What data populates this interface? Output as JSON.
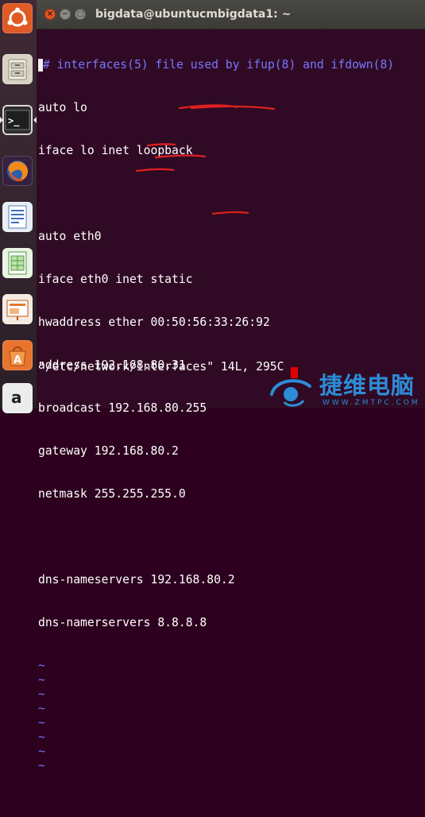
{
  "window": {
    "title": "bigdata@ubuntucmbigdata1: ~",
    "close_glyph": "×",
    "minimize_glyph": "−",
    "maximize_glyph": "□"
  },
  "launcher": {
    "items": [
      {
        "name": "Dash Home",
        "icon": "ubuntu-logo-icon"
      },
      {
        "name": "Files",
        "icon": "file-cabinet-icon"
      },
      {
        "name": "Terminal",
        "icon": "terminal-icon",
        "prompt": ">_"
      },
      {
        "name": "Firefox",
        "icon": "firefox-icon"
      },
      {
        "name": "LibreOffice Writer",
        "icon": "writer-icon"
      },
      {
        "name": "LibreOffice Calc",
        "icon": "calc-icon"
      },
      {
        "name": "LibreOffice Impress",
        "icon": "impress-icon"
      },
      {
        "name": "Ubuntu Software Center",
        "icon": "software-center-icon"
      },
      {
        "name": "Amazon",
        "icon": "amazon-icon",
        "letter": "a"
      }
    ]
  },
  "editor": {
    "lines": [
      "# interfaces(5) file used by ifup(8) and ifdown(8)",
      "auto lo",
      "iface lo inet loopback",
      "",
      "auto eth0",
      "iface eth0 inet static",
      "hwaddress ether 00:50:56:33:26:92",
      "address 192.168.80.31",
      "broadcast 192.168.80.255",
      "gateway 192.168.80.2",
      "netmask 255.255.255.0",
      "",
      "dns-nameservers 192.168.80.2",
      "dns-namerservers 8.8.8.8"
    ],
    "tilde": "~",
    "tilde_count": 8,
    "status": "\"/etc/network/interfaces\" 14L, 295C"
  },
  "watermark": {
    "text": "捷维电脑",
    "url": "WWW.ZMTPC.COM"
  },
  "colors": {
    "terminal_bg": "#300a24",
    "comment": "#7777ff",
    "annotation_red": "#e02020",
    "watermark_blue": "#2d8cd6"
  }
}
